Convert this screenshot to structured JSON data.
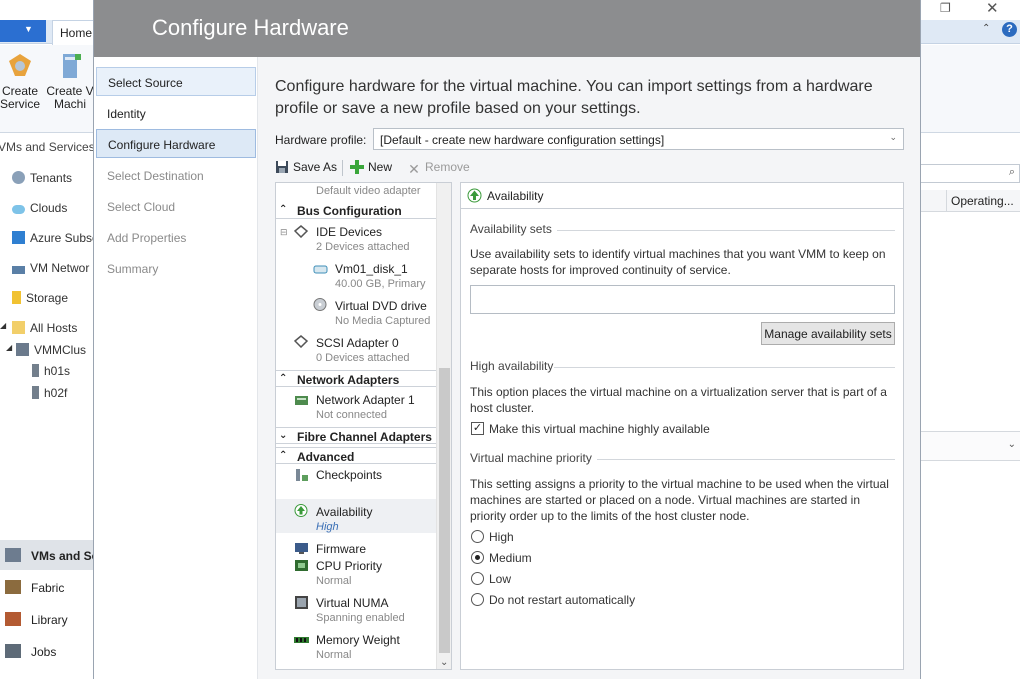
{
  "background": {
    "ribbon_tab_home": "Home",
    "ribbon_buttons": [
      {
        "label_line1": "Create",
        "label_line2": "Service"
      },
      {
        "label_line1": "Create V",
        "label_line2": "Machi"
      }
    ],
    "nav_header": "VMs and Services",
    "nav_items": [
      "Tenants",
      "Clouds",
      "Azure Subsc",
      "VM Networ",
      "Storage",
      "All Hosts",
      "VMMClus",
      "h01s",
      "h02f"
    ],
    "workspaces": [
      "VMs and Se",
      "Fabric",
      "Library",
      "Jobs"
    ],
    "column_header": "Operating..."
  },
  "dialog": {
    "title": "Configure Hardware",
    "steps": [
      {
        "label": "Select Source",
        "state": "selected"
      },
      {
        "label": "Identity",
        "state": "normal"
      },
      {
        "label": "Configure Hardware",
        "state": "current"
      },
      {
        "label": "Select Destination",
        "state": "disabled"
      },
      {
        "label": "Select Cloud",
        "state": "disabled"
      },
      {
        "label": "Add Properties",
        "state": "disabled"
      },
      {
        "label": "Summary",
        "state": "disabled"
      }
    ],
    "intro": "Configure hardware for the virtual machine. You can import settings from a hardware profile or save a new profile based on your settings.",
    "hardware_profile_label": "Hardware profile:",
    "hardware_profile_value": "[Default - create new hardware configuration settings]",
    "toolbar": {
      "save_as": "Save As",
      "new": "New",
      "remove": "Remove"
    },
    "tree": {
      "partial_item": "Default video adapter",
      "sections": {
        "bus": "Bus Configuration",
        "network": "Network Adapters",
        "fibre": "Fibre Channel Adapters",
        "advanced": "Advanced"
      },
      "ide": {
        "label": "IDE Devices",
        "sub": "2 Devices attached"
      },
      "disk": {
        "label": "Vm01_disk_1",
        "sub": "40.00 GB, Primary"
      },
      "dvd": {
        "label": "Virtual DVD drive",
        "sub": "No Media Captured"
      },
      "scsi": {
        "label": "SCSI Adapter 0",
        "sub": "0 Devices attached"
      },
      "netadapter": {
        "label": "Network Adapter 1",
        "sub": "Not connected"
      },
      "checkpoints": {
        "label": "Checkpoints"
      },
      "availability": {
        "label": "Availability",
        "sub": "High"
      },
      "firmware": {
        "label": "Firmware"
      },
      "cpu": {
        "label": "CPU Priority",
        "sub": "Normal"
      },
      "numa": {
        "label": "Virtual NUMA",
        "sub": "Spanning enabled"
      },
      "memory": {
        "label": "Memory Weight",
        "sub": "Normal"
      }
    },
    "panel": {
      "header": "Availability",
      "avail_sets_title": "Availability sets",
      "avail_sets_desc": "Use availability sets to identify virtual machines that you want VMM to keep on separate hosts for improved continuity of service.",
      "avail_sets_value": "",
      "manage_button": "Manage availability sets",
      "ha_title": "High availability",
      "ha_desc": "This option places the virtual machine on a virtualization server that is part of a host cluster.",
      "ha_checkbox_label": "Make this virtual machine highly available",
      "ha_checked": true,
      "priority_title": "Virtual machine priority",
      "priority_desc": "This setting assigns a priority to the virtual machine to be used when the virtual machines are started or placed on a node. Virtual machines are started in priority order up to the limits of the host cluster node.",
      "priority_options": [
        "High",
        "Medium",
        "Low",
        "Do not restart automatically"
      ],
      "priority_selected": "Medium"
    }
  }
}
